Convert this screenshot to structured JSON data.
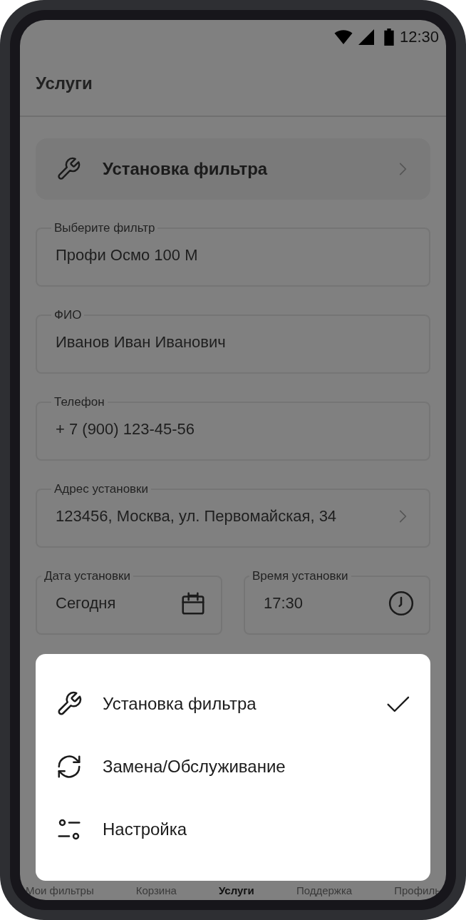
{
  "status_bar": {
    "time": "12:30"
  },
  "header": {
    "title": "Услуги"
  },
  "service_selector": {
    "label": "Установка фильтра"
  },
  "fields": [
    {
      "kind": "text",
      "label": "Выберите фильтр",
      "value": "Профи Осмо 100 М"
    },
    {
      "kind": "text",
      "label": "ФИО",
      "value": "Иванов Иван Иванович"
    },
    {
      "kind": "text",
      "label": "Телефон",
      "value": "+ 7 (900) 123-45-56"
    },
    {
      "kind": "link",
      "label": "Адрес установки",
      "value": "123456, Москва, ул. Первомайская, 34"
    }
  ],
  "schedule": [
    {
      "kind": "date",
      "label": "Дата установки",
      "value": "Сегодня"
    },
    {
      "kind": "time",
      "label": "Время установки",
      "value": "17:30"
    }
  ],
  "sheet": {
    "options": [
      {
        "kind": "wrench",
        "label": "Установка фильтра",
        "selected": true
      },
      {
        "kind": "refresh",
        "label": "Замена/Обслуживание",
        "selected": false
      },
      {
        "kind": "sliders",
        "label": "Настройка",
        "selected": false
      }
    ]
  },
  "bottom_nav": [
    {
      "label": "Мои фильтры",
      "selected": false
    },
    {
      "label": "Корзина",
      "selected": false
    },
    {
      "label": "Услуги",
      "selected": true
    },
    {
      "label": "Поддержка",
      "selected": false
    },
    {
      "label": "Профиль",
      "selected": false
    }
  ]
}
